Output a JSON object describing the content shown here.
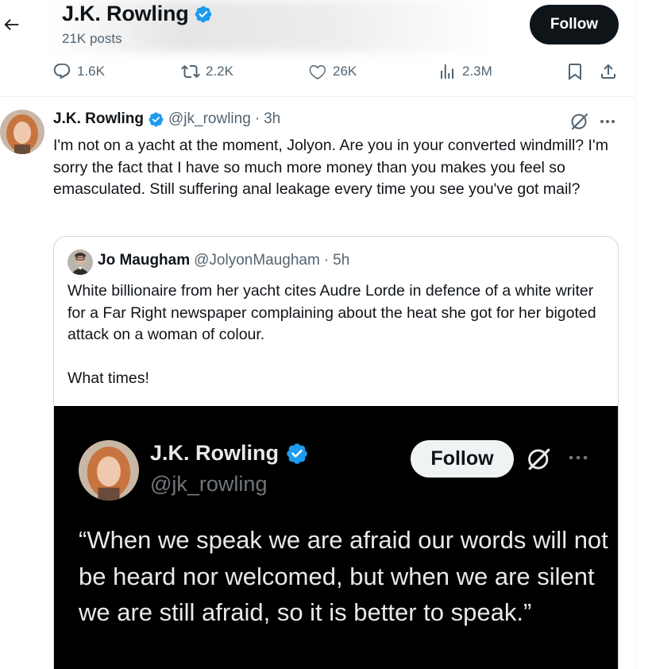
{
  "header": {
    "title": "J.K. Rowling",
    "posts_count": "21K posts",
    "follow_label": "Follow",
    "stats": {
      "replies": "1.6K",
      "reposts": "2.2K",
      "likes": "26K",
      "views": "2.3M"
    }
  },
  "tweet": {
    "author_name": "J.K. Rowling",
    "author_handle": "@jk_rowling",
    "separator": "·",
    "time": "3h",
    "text": "I'm not on a yacht at the moment, Jolyon. Are you in your converted windmill? I'm sorry the fact that I have so much more money than you makes you feel so emasculated. Still suffering anal leakage every time you see you've got mail?"
  },
  "quote": {
    "author_name": "Jo Maugham",
    "author_handle": "@JolyonMaugham",
    "separator": "·",
    "time": "5h",
    "text": "White billionaire from her yacht cites Audre Lorde in defence of a white writer for a Far Right newspaper complaining about the heat she got for her bigoted attack on a woman of colour.\n\nWhat times!",
    "media": {
      "author_name": "J.K. Rowling",
      "author_handle": "@jk_rowling",
      "follow_label": "Follow",
      "quote_text": "“When we speak we are afraid our words will not be heard nor welcomed, but when we are silent we are still afraid, so it is better to speak.”"
    }
  },
  "colors": {
    "verified_blue": "#1d9bf0",
    "text_primary": "#0f1419",
    "text_secondary": "#536471",
    "border": "#cfd9de"
  },
  "icons": [
    "back-arrow-icon",
    "verified-badge-icon",
    "reply-icon",
    "repost-icon",
    "like-icon",
    "views-icon",
    "bookmark-icon",
    "share-icon",
    "grok-icon",
    "more-icon"
  ]
}
